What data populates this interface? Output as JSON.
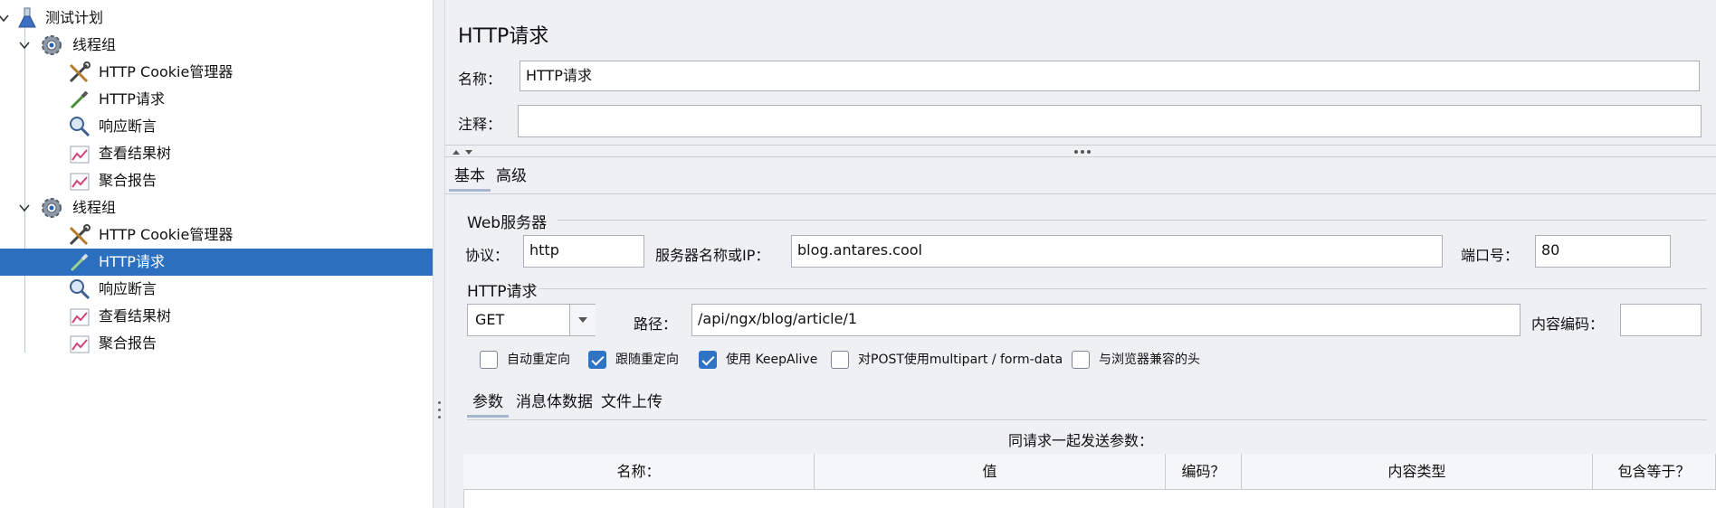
{
  "tree": {
    "items": [
      {
        "label": "测试计划",
        "icon": "flask-icon",
        "depth": 0,
        "expanded": true
      },
      {
        "label": "线程组",
        "icon": "gear-icon",
        "depth": 1,
        "expanded": true
      },
      {
        "label": "HTTP Cookie管理器",
        "icon": "tools-icon",
        "depth": 2
      },
      {
        "label": "HTTP请求",
        "icon": "pipette-icon",
        "depth": 2
      },
      {
        "label": "响应断言",
        "icon": "magnifier-icon",
        "depth": 2
      },
      {
        "label": "查看结果树",
        "icon": "graph-icon",
        "depth": 2
      },
      {
        "label": "聚合报告",
        "icon": "graph-icon",
        "depth": 2
      },
      {
        "label": "线程组",
        "icon": "gear-icon",
        "depth": 1,
        "expanded": true
      },
      {
        "label": "HTTP Cookie管理器",
        "icon": "tools-icon",
        "depth": 2
      },
      {
        "label": "HTTP请求",
        "icon": "pipette-icon",
        "depth": 2,
        "selected": true
      },
      {
        "label": "响应断言",
        "icon": "magnifier-icon",
        "depth": 2
      },
      {
        "label": "查看结果树",
        "icon": "graph-icon",
        "depth": 2
      },
      {
        "label": "聚合报告",
        "icon": "graph-icon",
        "depth": 2
      }
    ]
  },
  "panel": {
    "title": "HTTP请求",
    "name_label": "名称：",
    "name_value": "HTTP请求",
    "comment_label": "注释：",
    "comment_value": "",
    "tabs": [
      "基本",
      "高级"
    ],
    "web_server": {
      "section_title": "Web服务器",
      "protocol_label": "协议：",
      "protocol_value": "http",
      "server_label": "服务器名称或IP：",
      "server_value": "blog.antares.cool",
      "port_label": "端口号：",
      "port_value": "80"
    },
    "http_request": {
      "section_title": "HTTP请求",
      "method": "GET",
      "path_label": "路径：",
      "path_value": "/api/ngx/blog/article/1",
      "encoding_label": "内容编码：",
      "encoding_value": ""
    },
    "options": [
      {
        "label": "自动重定向",
        "checked": false
      },
      {
        "label": "跟随重定向",
        "checked": true
      },
      {
        "label": "使用 KeepAlive",
        "checked": true
      },
      {
        "label": "对POST使用multipart / form-data",
        "checked": false
      },
      {
        "label": "与浏览器兼容的头",
        "checked": false
      }
    ],
    "sub_tabs": [
      "参数",
      "消息体数据",
      "文件上传"
    ],
    "params_caption": "同请求一起发送参数：",
    "params_columns": [
      "名称：",
      "值",
      "编码？",
      "内容类型",
      "包含等于？"
    ]
  },
  "colors": {
    "selection": "#2c6fbe",
    "checkbox_on": "#2f73c5",
    "panel_bg": "#eef0f3"
  }
}
